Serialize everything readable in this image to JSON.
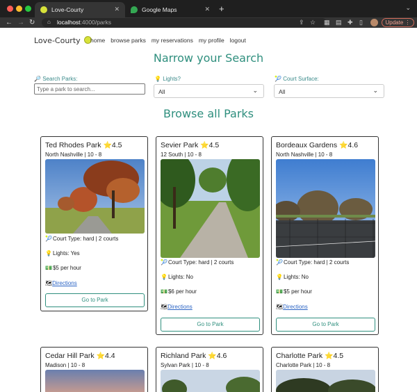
{
  "browser": {
    "tabs": [
      {
        "title": "Love-Courty",
        "active": true
      },
      {
        "title": "Google Maps",
        "active": false
      }
    ],
    "url_host": "localhost",
    "url_path": ":4000/parks",
    "update_label": "Update",
    "colors": {
      "close": "#ff5f57",
      "minimize": "#febc2e",
      "maximize": "#28c840"
    }
  },
  "app": {
    "brand": "Love-Courty",
    "nav": [
      "home",
      "browse parks",
      "my reservations",
      "my profile",
      "logout"
    ],
    "search_heading": "Narrow your Search",
    "filters": {
      "search_label": "Search Parks:",
      "search_placeholder": "Type a park to search...",
      "lights_label": "Lights?",
      "lights_value": "All",
      "surface_label": "Court Surface:",
      "surface_value": "All"
    },
    "browse_heading": "Browse all Parks",
    "accent_color": "#2f8f7e",
    "parks": [
      {
        "name": "Ted Rhodes Park",
        "rating": "4.5",
        "area": "North Nashville | 10 - 8",
        "court": "Court Type: hard | 2 courts",
        "lights": "Lights: Yes",
        "price": "$5 per hour",
        "directions": "Directions",
        "button": "Go to Park"
      },
      {
        "name": "Sevier Park",
        "rating": "4.5",
        "area": "12 South | 10 - 8",
        "court": "Court Type: hard | 2 courts",
        "lights": "Lights: No",
        "price": "$6 per hour",
        "directions": "Directions",
        "button": "Go to Park"
      },
      {
        "name": "Bordeaux Gardens",
        "rating": "4.6",
        "area": "North Nashville | 10 - 8",
        "court": "Court Type: hard | 2 courts",
        "lights": "Lights: No",
        "price": "$5 per hour",
        "directions": "Directions",
        "button": "Go to Park"
      },
      {
        "name": "Cedar Hill Park",
        "rating": "4.4",
        "area": "Madison | 10 - 8"
      },
      {
        "name": "Richland Park",
        "rating": "4.6",
        "area": "Sylvan Park | 10 - 8"
      },
      {
        "name": "Charlotte Park",
        "rating": "4.5",
        "area": "Charlotte Park | 10 - 8"
      }
    ],
    "star": "⭐"
  }
}
